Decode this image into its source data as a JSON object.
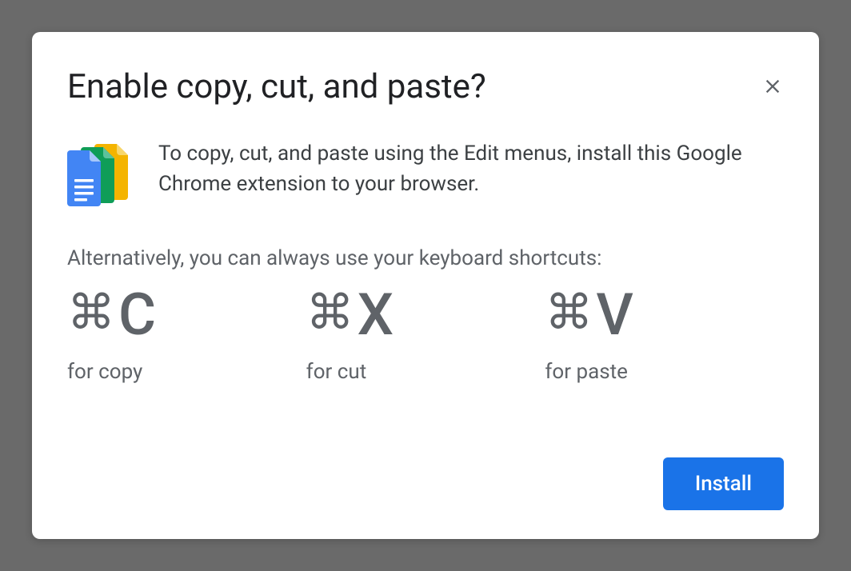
{
  "dialog": {
    "title": "Enable copy, cut, and paste?",
    "body": "To copy, cut, and paste using the Edit menus, install this Google Chrome extension to your browser.",
    "alt_intro": "Alternatively, you can always use your keyboard shortcuts:",
    "shortcuts": [
      {
        "modifier": "⌘",
        "key": "C",
        "label": "for copy"
      },
      {
        "modifier": "⌘",
        "key": "X",
        "label": "for cut"
      },
      {
        "modifier": "⌘",
        "key": "V",
        "label": "for paste"
      }
    ],
    "install_label": "Install"
  }
}
